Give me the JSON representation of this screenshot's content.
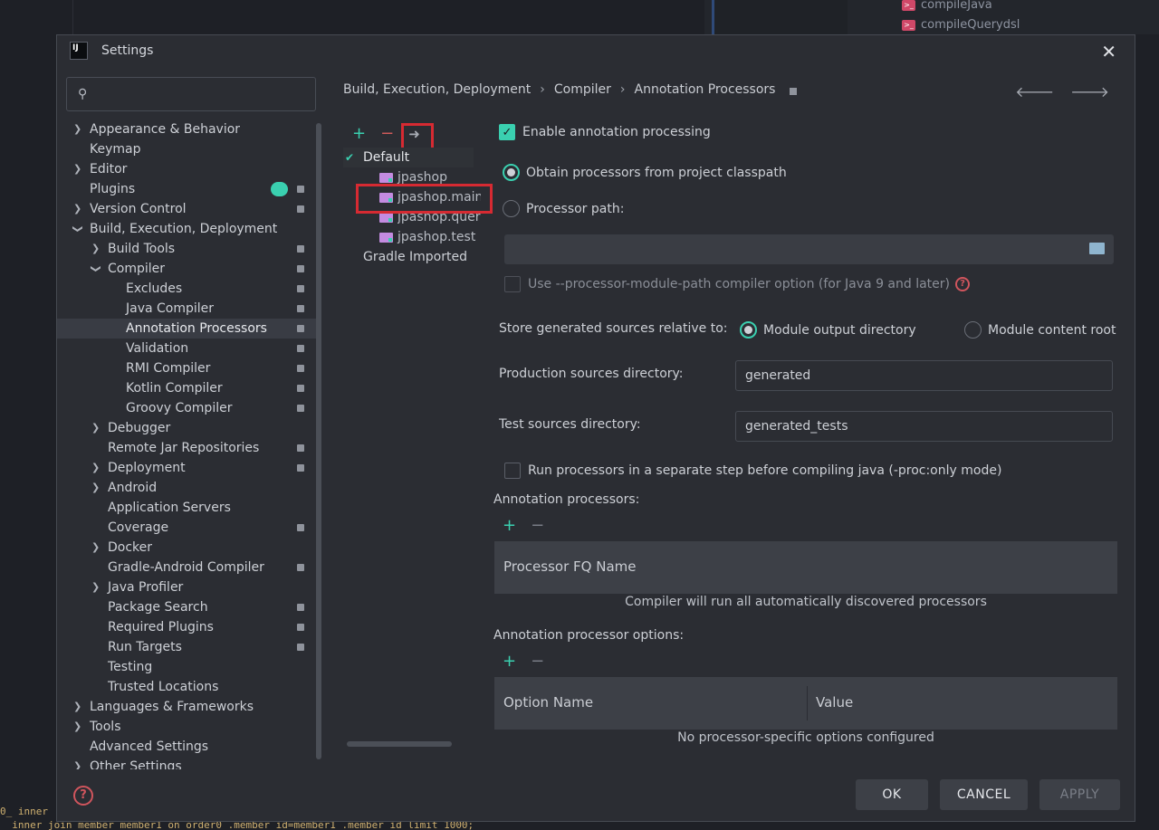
{
  "background": {
    "run_tasks": [
      "compileJava",
      "compileQuerydsl"
    ],
    "log_lines": [
      "0_ inner",
      "_ inner join member member1  on order0 .member_id=member1 .member_id limit 1000;"
    ]
  },
  "dialog": {
    "title": "Settings",
    "app_icon_text": "IJ"
  },
  "search": {
    "placeholder": ""
  },
  "sidebar": {
    "items": [
      {
        "label": "Appearance & Behavior"
      },
      {
        "label": "Keymap"
      },
      {
        "label": "Editor"
      },
      {
        "label": "Plugins"
      },
      {
        "label": "Version Control"
      },
      {
        "label": "Build, Execution, Deployment"
      },
      {
        "label": "Build Tools"
      },
      {
        "label": "Compiler"
      },
      {
        "label": "Excludes"
      },
      {
        "label": "Java Compiler"
      },
      {
        "label": "Annotation Processors"
      },
      {
        "label": "Validation"
      },
      {
        "label": "RMI Compiler"
      },
      {
        "label": "Kotlin Compiler"
      },
      {
        "label": "Groovy Compiler"
      },
      {
        "label": "Debugger"
      },
      {
        "label": "Remote Jar Repositories"
      },
      {
        "label": "Deployment"
      },
      {
        "label": "Android"
      },
      {
        "label": "Application Servers"
      },
      {
        "label": "Coverage"
      },
      {
        "label": "Docker"
      },
      {
        "label": "Gradle-Android Compiler"
      },
      {
        "label": "Java Profiler"
      },
      {
        "label": "Package Search"
      },
      {
        "label": "Required Plugins"
      },
      {
        "label": "Run Targets"
      },
      {
        "label": "Testing"
      },
      {
        "label": "Trusted Locations"
      },
      {
        "label": "Languages & Frameworks"
      },
      {
        "label": "Tools"
      },
      {
        "label": "Advanced Settings"
      },
      {
        "label": "Other Settings"
      }
    ]
  },
  "breadcrumb": {
    "parts": [
      "Build, Execution, Deployment",
      "Compiler",
      "Annotation Processors"
    ],
    "separator": "›"
  },
  "profiles": {
    "tools": {
      "add": "+",
      "remove": "−",
      "move": "➜"
    },
    "items": [
      {
        "label": "Default"
      },
      {
        "label": "jpashop"
      },
      {
        "label": "jpashop.main"
      },
      {
        "label": "jpashop.querydsl"
      },
      {
        "label": "jpashop.test"
      },
      {
        "label": "Gradle Imported"
      }
    ]
  },
  "settings": {
    "enable_annotation_processing": "Enable annotation processing",
    "obtain_from_classpath": "Obtain processors from project classpath",
    "processor_path": "Processor path:",
    "processor_path_value": "",
    "use_module_path": "Use --processor-module-path compiler option (for Java 9 and later)",
    "store_generated_label": "Store generated sources relative to:",
    "module_output_directory": "Module output directory",
    "module_content_root": "Module content root",
    "production_sources_label": "Production sources directory:",
    "production_sources_value": "generated",
    "test_sources_label": "Test sources directory:",
    "test_sources_value": "generated_tests",
    "run_separate_step": "Run processors in a separate step before compiling java (-proc:only mode)",
    "annotation_processors_label": "Annotation processors:",
    "processor_fq_name_header": "Processor FQ Name",
    "processors_empty": "Compiler will run all automatically discovered processors",
    "processor_options_label": "Annotation processor options:",
    "option_name_header": "Option Name",
    "value_header": "Value",
    "options_empty": "No processor-specific options configured"
  },
  "buttons": {
    "ok": "OK",
    "cancel": "CANCEL",
    "apply": "APPLY"
  },
  "colors": {
    "accent": "#3ad0b0",
    "highlight_box": "#d62a32",
    "folder": "#c38be0"
  }
}
